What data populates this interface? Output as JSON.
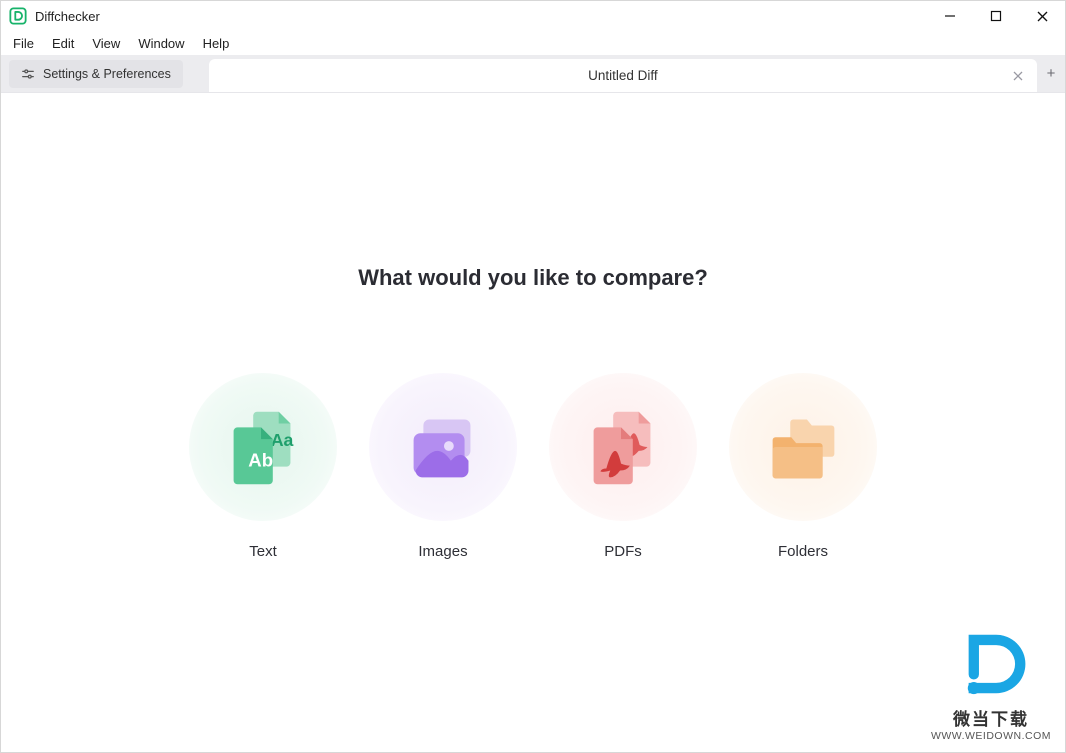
{
  "window": {
    "title": "Diffchecker"
  },
  "menu": {
    "items": [
      "File",
      "Edit",
      "View",
      "Window",
      "Help"
    ]
  },
  "toolbar": {
    "settings_label": "Settings & Preferences"
  },
  "tab": {
    "title": "Untitled Diff"
  },
  "main": {
    "headline": "What would you like to compare?",
    "options": [
      {
        "key": "text",
        "label": "Text"
      },
      {
        "key": "images",
        "label": "Images"
      },
      {
        "key": "pdfs",
        "label": "PDFs"
      },
      {
        "key": "folders",
        "label": "Folders"
      }
    ]
  },
  "watermark": {
    "cn": "微当下载",
    "url": "WWW.WEIDOWN.COM"
  }
}
